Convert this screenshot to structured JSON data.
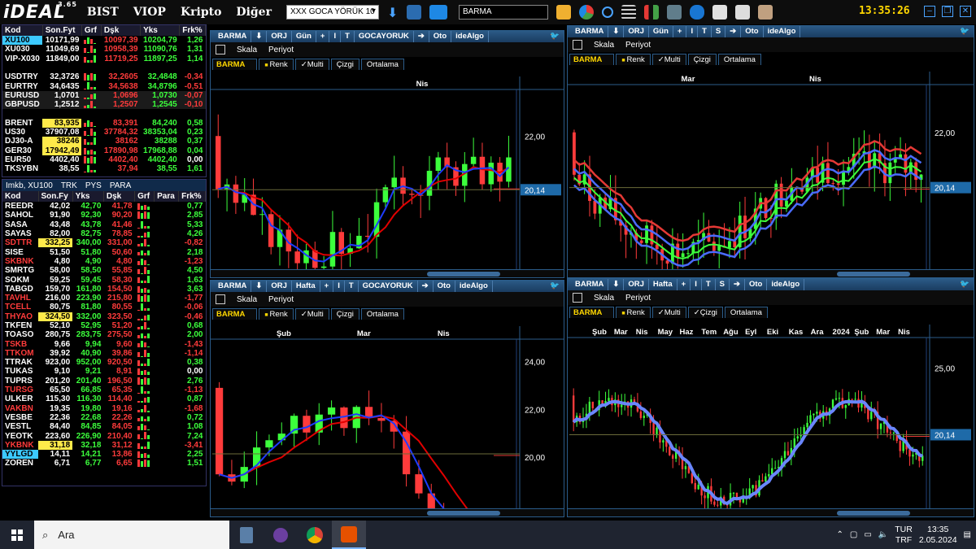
{
  "app": {
    "logo": "iDEAL",
    "version": "3.65",
    "menu": [
      "BIST",
      "VIOP",
      "Kripto",
      "Diğer"
    ],
    "selector": "XXX GOCA YÖRÜK 10",
    "search": "BARMA",
    "clock": "13:35:26"
  },
  "market": {
    "headers": [
      "Kod",
      "Son.Fyt",
      "Grf",
      "Dşk",
      "Yks",
      "Frk%"
    ],
    "rows": [
      {
        "kod": "XU100",
        "son": "10171,99",
        "dsk": "10097,39",
        "yks": "10204,79",
        "frk": "1,26",
        "hl": "c"
      },
      {
        "kod": "XU030",
        "son": "11049,69",
        "dsk": "10958,39",
        "yks": "11090,76",
        "frk": "1,31"
      },
      {
        "kod": "VIP-X030",
        "son": "11849,00",
        "dsk": "11719,25",
        "yks": "11897,25",
        "frk": "1,14"
      },
      {
        "kod": "",
        "son": "",
        "dsk": "",
        "yks": "",
        "frk": ""
      },
      {
        "kod": "USDTRY",
        "son": "32,3726",
        "dsk": "32,2605",
        "yks": "32,4848",
        "frk": "-0,34"
      },
      {
        "kod": "EURTRY",
        "son": "34,6435",
        "dsk": "34,5638",
        "yks": "34,8796",
        "frk": "-0,51"
      },
      {
        "kod": "EURUSD",
        "son": "1,0701",
        "dsk": "1,0696",
        "yks": "1,0730",
        "frk": "-0,07"
      },
      {
        "kod": "GBPUSD",
        "son": "1,2512",
        "dsk": "1,2507",
        "yks": "1,2545",
        "frk": "-0,10"
      },
      {
        "kod": "",
        "son": "",
        "dsk": "",
        "yks": "",
        "frk": ""
      },
      {
        "kod": "BRENT",
        "son": "83,935",
        "dsk": "83,391",
        "yks": "84,240",
        "frk": "0,58",
        "hl": "y"
      },
      {
        "kod": "US30",
        "son": "37907,08",
        "dsk": "37784,32",
        "yks": "38353,04",
        "frk": "0,23"
      },
      {
        "kod": "DJ30-A",
        "son": "38246",
        "dsk": "38162",
        "yks": "38288",
        "frk": "0,37",
        "hl": "y"
      },
      {
        "kod": "GER30",
        "son": "17942,49",
        "dsk": "17890,98",
        "yks": "17968,88",
        "frk": "0,04",
        "hl": "y"
      },
      {
        "kod": "EUR50",
        "son": "4402,40",
        "dsk": "4402,40",
        "yks": "4402,40",
        "frk": "0,00"
      },
      {
        "kod": "TKSYBN",
        "son": "38,55",
        "dsk": "37,94",
        "yks": "38,55",
        "frk": "1,61"
      }
    ]
  },
  "stocks": {
    "tabs": [
      "Imkb, XU100",
      "TRK",
      "PYS",
      "PARA"
    ],
    "headers": [
      "Kod",
      "Son.Fy",
      "Yks",
      "Dşk",
      "Grf",
      "Para",
      "Frk%"
    ],
    "rows": [
      {
        "kod": "REEDR",
        "son": "42,02",
        "yks": "42,70",
        "dsk": "41,78",
        "frk": "0,77"
      },
      {
        "kod": "SAHOL",
        "son": "91,90",
        "yks": "92,30",
        "dsk": "90,20",
        "frk": "2,85"
      },
      {
        "kod": "SASA",
        "son": "43,48",
        "yks": "43,78",
        "dsk": "41,46",
        "frk": "5,33"
      },
      {
        "kod": "SAYAS",
        "son": "82,00",
        "yks": "82,75",
        "dsk": "78,85",
        "frk": "4,26"
      },
      {
        "kod": "SDTTR",
        "son": "332,25",
        "yks": "340,00",
        "dsk": "331,00",
        "frk": "-0,82",
        "hl": "y"
      },
      {
        "kod": "SISE",
        "son": "51,50",
        "yks": "51,80",
        "dsk": "50,60",
        "frk": "2,18"
      },
      {
        "kod": "SKBNK",
        "son": "4,80",
        "yks": "4,90",
        "dsk": "4,80",
        "frk": "-1,23"
      },
      {
        "kod": "SMRTG",
        "son": "58,00",
        "yks": "58,50",
        "dsk": "55,85",
        "frk": "4,50"
      },
      {
        "kod": "SOKM",
        "son": "59,25",
        "yks": "59,45",
        "dsk": "58,30",
        "frk": "1,63"
      },
      {
        "kod": "TABGD",
        "son": "159,70",
        "yks": "161,80",
        "dsk": "154,50",
        "frk": "3,63"
      },
      {
        "kod": "TAVHL",
        "son": "216,00",
        "yks": "223,90",
        "dsk": "215,80",
        "frk": "-1,77"
      },
      {
        "kod": "TCELL",
        "son": "80,75",
        "yks": "81,80",
        "dsk": "80,55",
        "frk": "-0,06"
      },
      {
        "kod": "THYAO",
        "son": "324,50",
        "yks": "332,00",
        "dsk": "323,50",
        "frk": "-0,46",
        "hl": "y"
      },
      {
        "kod": "TKFEN",
        "son": "52,10",
        "yks": "52,95",
        "dsk": "51,20",
        "frk": "0,68"
      },
      {
        "kod": "TOASO",
        "son": "280,75",
        "yks": "283,75",
        "dsk": "275,50",
        "frk": "2,00"
      },
      {
        "kod": "TSKB",
        "son": "9,66",
        "yks": "9,94",
        "dsk": "9,60",
        "frk": "-1,43"
      },
      {
        "kod": "TTKOM",
        "son": "39,92",
        "yks": "40,90",
        "dsk": "39,86",
        "frk": "-1,14"
      },
      {
        "kod": "TTRAK",
        "son": "923,00",
        "yks": "952,00",
        "dsk": "920,50",
        "frk": "0,38"
      },
      {
        "kod": "TUKAS",
        "son": "9,10",
        "yks": "9,21",
        "dsk": "8,91",
        "frk": "0,00"
      },
      {
        "kod": "TUPRS",
        "son": "201,20",
        "yks": "201,40",
        "dsk": "196,50",
        "frk": "2,76"
      },
      {
        "kod": "TURSG",
        "son": "65,50",
        "yks": "66,85",
        "dsk": "65,35",
        "frk": "-1,13"
      },
      {
        "kod": "ULKER",
        "son": "115,30",
        "yks": "116,30",
        "dsk": "114,40",
        "frk": "0,87"
      },
      {
        "kod": "VAKBN",
        "son": "19,35",
        "yks": "19,80",
        "dsk": "19,16",
        "frk": "-1,68"
      },
      {
        "kod": "VESBE",
        "son": "22,36",
        "yks": "22,68",
        "dsk": "22,26",
        "frk": "0,72"
      },
      {
        "kod": "VESTL",
        "son": "84,40",
        "yks": "84,85",
        "dsk": "84,05",
        "frk": "1,08"
      },
      {
        "kod": "YEOTK",
        "son": "223,60",
        "yks": "226,90",
        "dsk": "210,40",
        "frk": "7,24"
      },
      {
        "kod": "YKBNK",
        "son": "31,18",
        "yks": "32,18",
        "dsk": "31,12",
        "frk": "-3,41",
        "hl": "y"
      },
      {
        "kod": "YYLGD",
        "son": "14,11",
        "yks": "14,21",
        "dsk": "13,86",
        "frk": "2,25",
        "hl": "c"
      },
      {
        "kod": "ZOREN",
        "son": "6,71",
        "yks": "6,77",
        "dsk": "6,65",
        "frk": "1,51"
      }
    ]
  },
  "charts": [
    {
      "period": "Gün",
      "owner": "GOCAYORUK",
      "months": [
        "Nis"
      ],
      "ticks": [
        "22,00",
        "20,14"
      ],
      "ymin": 17.5,
      "ymax": 23.5,
      "mode": "redblue",
      "seed": 3,
      "n": 34
    },
    {
      "period": "Gün",
      "owner": "",
      "months": [
        "Mar",
        "Nis"
      ],
      "ticks": [
        "22,00",
        "20,14"
      ],
      "ymin": 17.5,
      "ymax": 23.5,
      "mode": "ribbon",
      "seed": 7,
      "n": 68
    },
    {
      "period": "Hafta",
      "owner": "GOCAYORUK",
      "months": [
        "Şub",
        "Mar",
        "Nis"
      ],
      "ticks": [
        "24,00",
        "22,00",
        "20,00"
      ],
      "ymin": 18.0,
      "ymax": 24.8,
      "mode": "redblue",
      "seed": 11,
      "n": 24
    },
    {
      "period": "Hafta",
      "owner": "",
      "months": [
        "Şub",
        "Mar",
        "Nis",
        "May",
        "Haz",
        "Tem",
        "Ağu",
        "Eyl",
        "Eki",
        "Kas",
        "Ara",
        "2024",
        "Şub",
        "Mar",
        "Nis"
      ],
      "ticks": [
        "25,00",
        "20,14"
      ],
      "ymin": 15.0,
      "ymax": 27.0,
      "mode": "blue",
      "seed": 19,
      "n": 110
    }
  ],
  "chart_common": {
    "symbol": "BARMA",
    "orj": "ORJ",
    "oto": "Oto",
    "algo": "ideAlgo",
    "skala": "Skala",
    "periyot": "Periyot",
    "renk": "Renk",
    "multi": "✓Multi",
    "cizgi": "Çizgi",
    "cizgi_checked": "✓Çizgi",
    "ortalama": "Ortalama",
    "price_label": "20,14"
  },
  "taskbar": {
    "search": "Ara",
    "lang": [
      "TUR",
      "TRF"
    ],
    "time": "13:35",
    "date": "2.05.2024"
  },
  "colors": {
    "up": "#3cff3c",
    "down": "#ff3b3b",
    "accent": "#2b5c8a",
    "clock": "#ffd700"
  }
}
